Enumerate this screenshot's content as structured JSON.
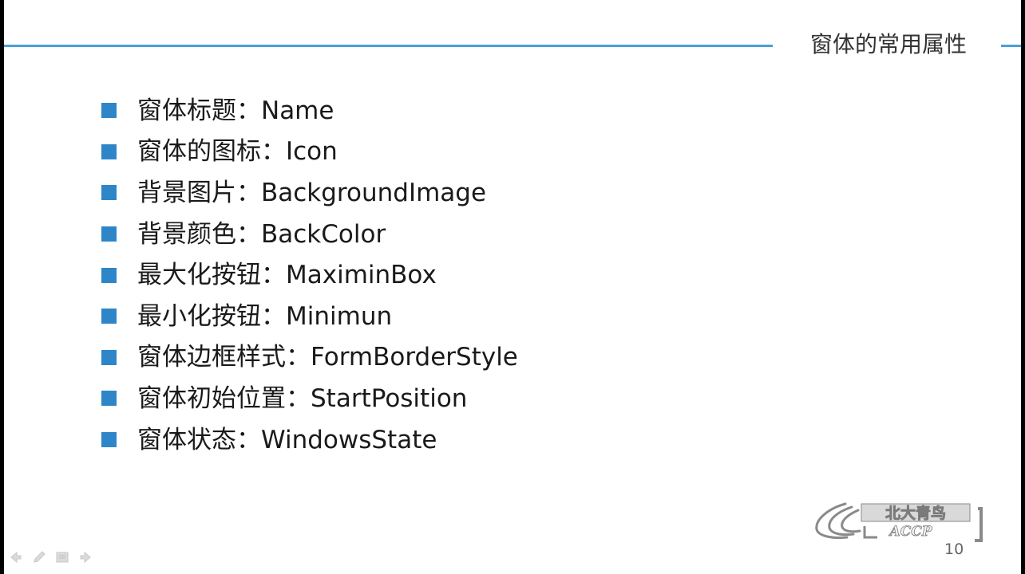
{
  "slide": {
    "heading": "窗体的常用属性",
    "page_number": "10",
    "accent_color": "#2e86c8",
    "rule_color": "#4aa0d8",
    "bullets": [
      {
        "label": "窗体标题：Name"
      },
      {
        "label": "窗体的图标：Icon"
      },
      {
        "label": "背景图片：BackgroundImage"
      },
      {
        "label": "背景颜色：BackColor"
      },
      {
        "label": "最大化按钮：MaximinBox"
      },
      {
        "label": "最小化按钮：Minimun"
      },
      {
        "label": "窗体边框样式：FormBorderStyle"
      },
      {
        "label": "窗体初始位置：StartPosition"
      },
      {
        "label": "窗体状态：WindowsState"
      }
    ]
  },
  "logo": {
    "name": "北大青鸟",
    "subtext": "ACCP",
    "icon": "wing-swoosh-icon"
  },
  "nav": {
    "icons": [
      "back-arrow-icon",
      "pen-icon",
      "menu-icon",
      "forward-arrow-icon"
    ]
  }
}
